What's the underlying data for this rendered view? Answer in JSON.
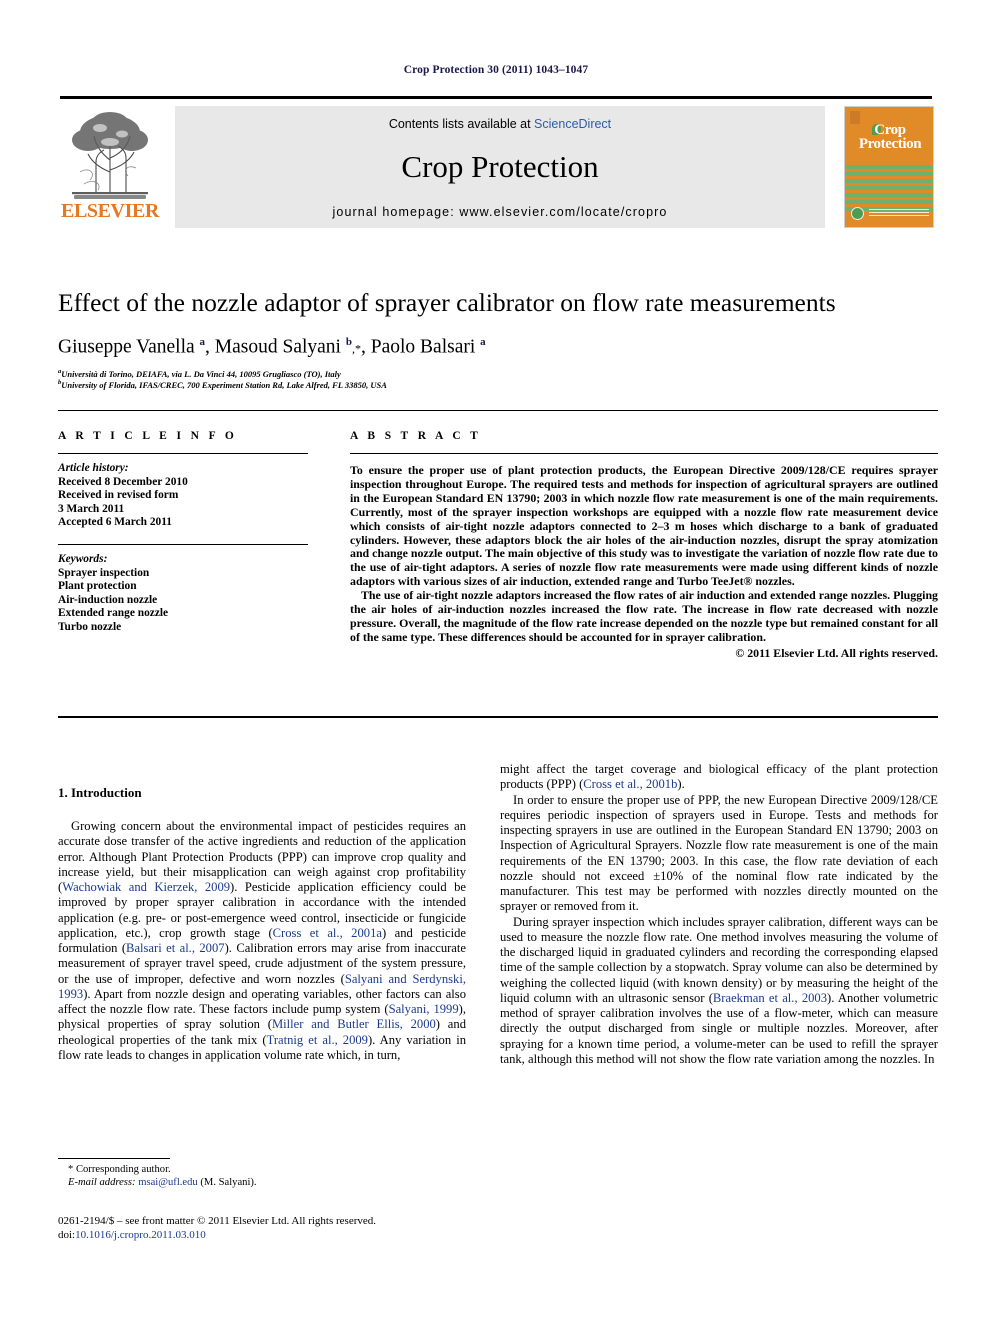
{
  "running_head": "Crop Protection 30 (2011) 1043–1047",
  "masthead": {
    "contents_prefix": "Contents lists available at ",
    "sciencedirect": "ScienceDirect",
    "journal_title": "Crop Protection",
    "homepage": "journal homepage: www.elsevier.com/locate/cropro",
    "publisher_logo_text": "ELSEVIER",
    "cover_title_line1": "Crop",
    "cover_title_line2": "Protection",
    "accent_orange": "#E87722",
    "cover_orange": "#E08A28",
    "link_blue": "#2a5caa"
  },
  "article": {
    "title": "Effect of the nozzle adaptor of sprayer calibrator on flow rate measurements",
    "authors_html": "Giuseppe Vanella <sup>a</sup>, Masoud Salyani <sup>b</sup><span class=\"star\">,*</span>, Paolo Balsari <sup>a</sup>",
    "affiliation_a": "Università di Torino, DEIAFA, via L. Da Vinci 44, 10095 Grugliasco (TO), Italy",
    "affiliation_b": "University of Florida, IFAS/CREC, 700 Experiment Station Rd, Lake Alfred, FL 33850, USA",
    "affiliation_a_mark": "a",
    "affiliation_b_mark": "b"
  },
  "info": {
    "heading": "A R T I C L E   I N F O",
    "history_label": "Article history:",
    "history_lines": [
      "Received 8 December 2010",
      "Received in revised form",
      "3 March 2011",
      "Accepted 6 March 2011"
    ],
    "keywords_label": "Keywords:",
    "keywords": [
      "Sprayer inspection",
      "Plant protection",
      "Air-induction nozzle",
      "Extended range nozzle",
      "Turbo nozzle"
    ]
  },
  "abstract": {
    "heading": "A B S T R A C T",
    "paragraph1": "To ensure the proper use of plant protection products, the European Directive 2009/128/CE requires sprayer inspection throughout Europe. The required tests and methods for inspection of agricultural sprayers are outlined in the European Standard EN 13790; 2003 in which nozzle flow rate measurement is one of the main requirements. Currently, most of the sprayer inspection workshops are equipped with a nozzle flow rate measurement device which consists of air-tight nozzle adaptors connected to 2–3 m hoses which discharge to a bank of graduated cylinders. However, these adaptors block the air holes of the air-induction nozzles, disrupt the spray atomization and change nozzle output. The main objective of this study was to investigate the variation of nozzle flow rate due to the use of air-tight adaptors. A series of nozzle flow rate measurements were made using different kinds of nozzle adaptors with various sizes of air induction, extended range and Turbo TeeJet® nozzles.",
    "paragraph2": "The use of air-tight nozzle adaptors increased the flow rates of air induction and extended range nozzles. Plugging the air holes of air-induction nozzles increased the flow rate. The increase in flow rate decreased with nozzle pressure. Overall, the magnitude of the flow rate increase depended on the nozzle type but remained constant for all of the same type. These differences should be accounted for in sprayer calibration.",
    "copyright": "© 2011 Elsevier Ltd. All rights reserved."
  },
  "body": {
    "section_heading": "1. Introduction",
    "left_p1_html": "Growing concern about the environmental impact of pesticides requires an accurate dose transfer of the active ingredients and reduction of the application error. Although Plant Protection Products (PPP) can improve crop quality and increase yield, but their misapplication can weigh against crop profitability (<span class=\"ref\">Wachowiak and Kierzek, 2009</span>). Pesticide application efficiency could be improved by proper sprayer calibration in accordance with the intended application (e.g. pre- or post-emergence weed control, insecticide or fungicide application, etc.), crop growth stage (<span class=\"ref\">Cross et al., 2001a</span>) and pesticide formulation (<span class=\"ref\">Balsari et al., 2007</span>). Calibration errors may arise from inaccurate measurement of sprayer travel speed, crude adjustment of the system pressure, or the use of improper, defective and worn nozzles (<span class=\"ref\">Salyani and Serdynski, 1993</span>). Apart from nozzle design and operating variables, other factors can also affect the nozzle flow rate. These factors include pump system (<span class=\"ref\">Salyani, 1999</span>), physical properties of spray solution (<span class=\"ref\">Miller and Butler Ellis, 2000</span>) and rheological properties of the tank mix (<span class=\"ref\">Tratnig et al., 2009</span>). Any variation in flow rate leads to changes in application volume rate which, in turn,",
    "right_p1_html": "might affect the target coverage and biological efficacy of the plant protection products (PPP) (<span class=\"ref\">Cross et al., 2001b</span>).",
    "right_p2_html": "In order to ensure the proper use of PPP, the new European Directive 2009/128/CE requires periodic inspection of sprayers used in Europe. Tests and methods for inspecting sprayers in use are outlined in the European Standard EN 13790; 2003 on Inspection of Agricultural Sprayers. Nozzle flow rate measurement is one of the main requirements of the EN 13790; 2003. In this case, the flow rate deviation of each nozzle should not exceed ±10% of the nominal flow rate indicated by the manufacturer. This test may be performed with nozzles directly mounted on the sprayer or removed from it.",
    "right_p3_html": "During sprayer inspection which includes sprayer calibration, different ways can be used to measure the nozzle flow rate. One method involves measuring the volume of the discharged liquid in graduated cylinders and recording the corresponding elapsed time of the sample collection by a stopwatch. Spray volume can also be determined by weighing the collected liquid (with known density) or by measuring the height of the liquid column with an ultrasonic sensor (<span class=\"ref\">Braekman et al., 2003</span>). Another volumetric method of sprayer calibration involves the use of a flow-meter, which can measure directly the output discharged from single or multiple nozzles. Moreover, after spraying for a known time period, a volume-meter can be used to refill the sprayer tank, although this method will not show the flow rate variation among the nozzles. In"
  },
  "footer": {
    "corresponding_author": "* Corresponding author.",
    "email_label": "E-mail address:",
    "email": "msai@ufl.edu",
    "email_owner": "(M. Salyani).",
    "issn_line": "0261-2194/$ – see front matter © 2011 Elsevier Ltd. All rights reserved.",
    "doi_label": "doi:",
    "doi": "10.1016/j.cropro.2011.03.010"
  }
}
